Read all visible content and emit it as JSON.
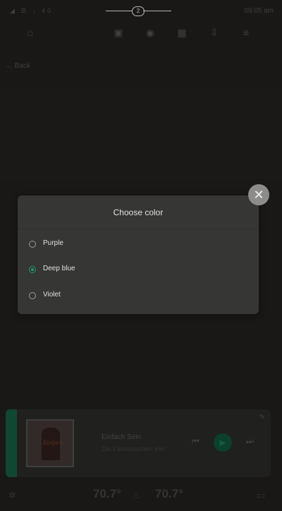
{
  "status_bar": {
    "signal": "◢ ☰ ↓ 40",
    "page_number": "2",
    "time": "09:05 am"
  },
  "nav": {
    "icons": [
      "home-icon",
      "gamepad-icon",
      "gauge-icon",
      "calendar-icon",
      "download-icon",
      "menu-icon"
    ]
  },
  "back_label": "Back",
  "dialog": {
    "title": "Choose color",
    "options": [
      {
        "label": "Purple",
        "selected": false
      },
      {
        "label": "Deep blue",
        "selected": true
      },
      {
        "label": "Violet",
        "selected": false
      }
    ],
    "close_symbol": "✕"
  },
  "player": {
    "album_art_text": "Einfach",
    "track_title": "Einfach Sein",
    "artist": "Die Fantastischen Vier",
    "prev_symbol": "⏮",
    "play_symbol": "▶",
    "next_symbol": "⏭",
    "edit_symbol": "✎"
  },
  "climate": {
    "left_temp": "70.7°",
    "right_temp": "70.7°",
    "fan_symbol": "✲",
    "seat_symbol": "♨",
    "right_symbol": "▭"
  },
  "colors": {
    "accent": "#1f9a6e",
    "background": "#1e1d1b",
    "dialog_bg": "#363634"
  }
}
